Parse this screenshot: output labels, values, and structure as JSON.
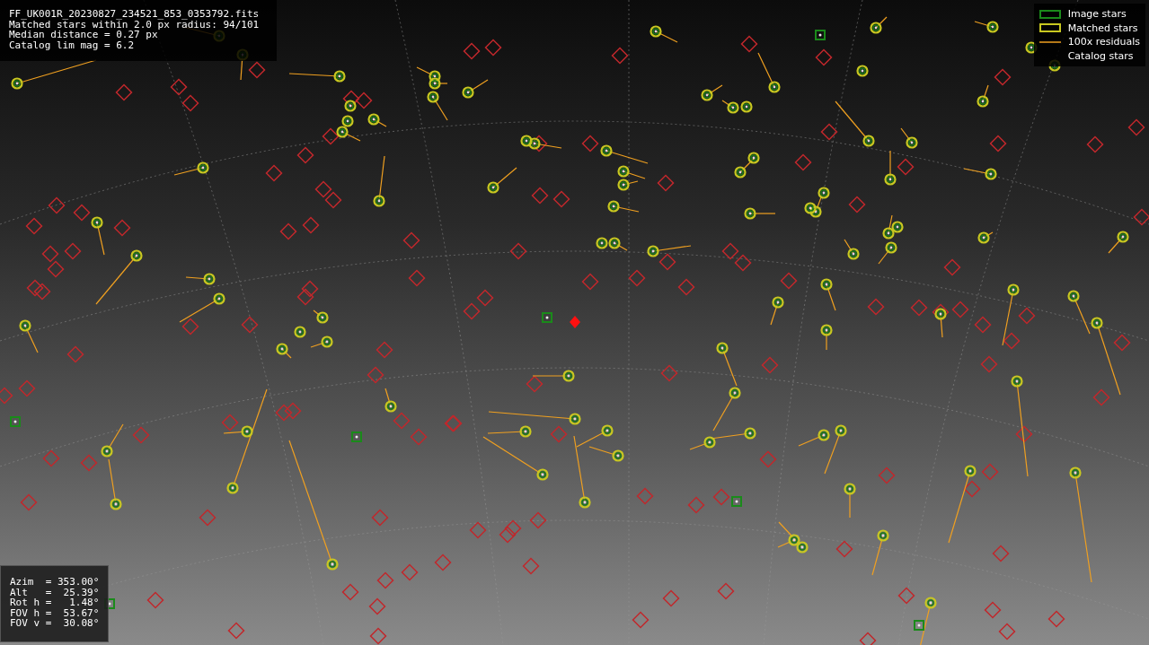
{
  "info": {
    "lines": [
      "FF_UK001R_20230827_234521_853_0353792.fits",
      "Matched stars within 2.0 px radius: 94/101",
      "Median distance = 0.27 px",
      "Catalog lim mag = 6.2"
    ]
  },
  "legend": {
    "items": [
      {
        "kind": "image",
        "label": "Image stars"
      },
      {
        "kind": "matched",
        "label": "Matched stars"
      },
      {
        "kind": "residual",
        "label": "100x residuals"
      },
      {
        "kind": "catalog",
        "label": "Catalog stars"
      }
    ]
  },
  "pointing": {
    "lines": [
      "Azim  = 353.00°",
      "Alt   =  25.39°",
      "Rot h =   1.48°",
      "FOV h =  53.67°",
      "FOV v =  30.08°"
    ]
  }
}
